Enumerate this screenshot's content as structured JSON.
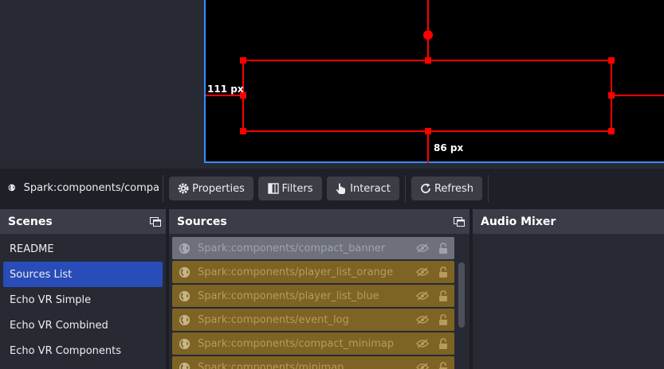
{
  "preview": {
    "left_distance_label": "111 px",
    "bottom_distance_label": "86 px"
  },
  "toolbar": {
    "source_name": "Spark:components/compa",
    "properties_label": "Properties",
    "filters_label": "Filters",
    "interact_label": "Interact",
    "refresh_label": "Refresh"
  },
  "scenes": {
    "title": "Scenes",
    "items": [
      {
        "label": "README"
      },
      {
        "label": "Sources List"
      },
      {
        "label": "Echo VR Simple"
      },
      {
        "label": "Echo VR Combined"
      },
      {
        "label": "Echo VR Components"
      }
    ],
    "selected": "Sources List"
  },
  "sources": {
    "title": "Sources",
    "items": [
      {
        "label": "Spark:components/compact_banner"
      },
      {
        "label": "Spark:components/player_list_orange"
      },
      {
        "label": "Spark:components/player_list_blue"
      },
      {
        "label": "Spark:components/event_log"
      },
      {
        "label": "Spark:components/compact_minimap"
      },
      {
        "label": "Spark:components/minimap"
      }
    ],
    "selected": "Spark:components/compact_banner"
  },
  "audio": {
    "title": "Audio Mixer"
  },
  "colors": {
    "selection_red": "#ff0000",
    "canvas_border": "#3a8cff",
    "scene_active": "#284cb8",
    "source_bg": "#7d6424"
  }
}
